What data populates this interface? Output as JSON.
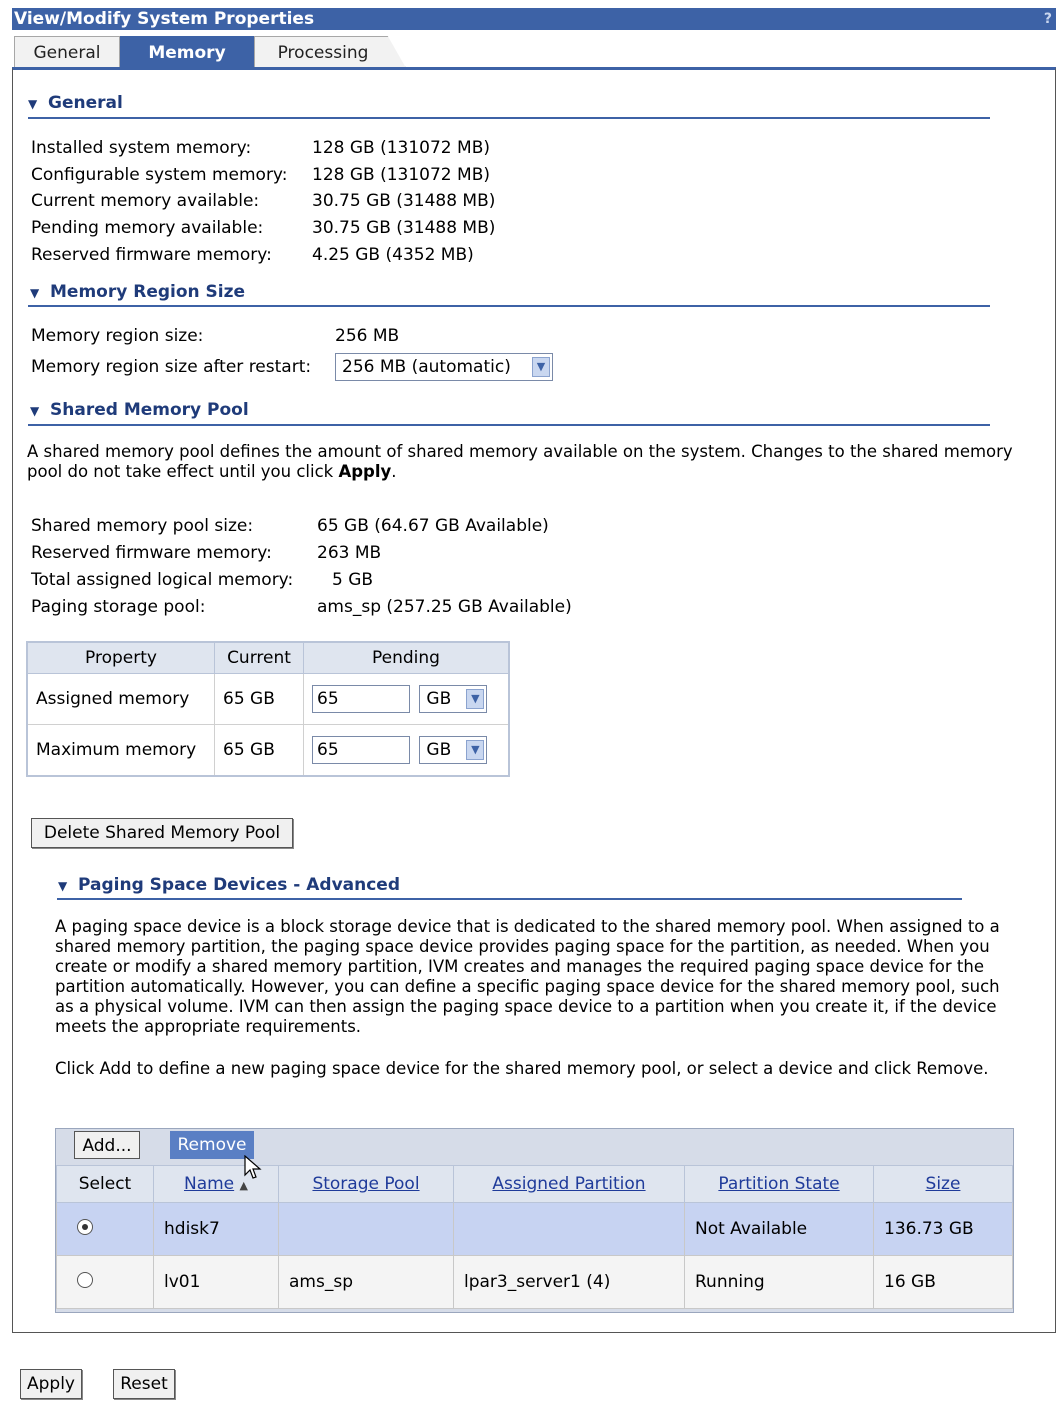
{
  "window": {
    "title": "View/Modify System Properties",
    "help": "?"
  },
  "tabs": [
    {
      "label": "General"
    },
    {
      "label": "Memory"
    },
    {
      "label": "Processing"
    }
  ],
  "general": {
    "heading": "General",
    "rows": [
      {
        "label": "Installed system memory:",
        "value": "128 GB (131072 MB)"
      },
      {
        "label": "Configurable system memory:",
        "value": "128 GB (131072 MB)"
      },
      {
        "label": "Current memory available:",
        "value": "30.75 GB (31488 MB)"
      },
      {
        "label": "Pending memory available:",
        "value": "30.75 GB (31488 MB)"
      },
      {
        "label": "Reserved firmware memory:",
        "value": "4.25 GB (4352 MB)"
      }
    ]
  },
  "region": {
    "heading": "Memory Region Size",
    "size_label": "Memory region size:",
    "size_value": "256 MB",
    "restart_label": "Memory region size after restart:",
    "restart_value": "256 MB (automatic)"
  },
  "pool": {
    "heading": "Shared Memory Pool",
    "desc_pre": "A shared memory pool defines the amount of shared memory available on the system. Changes to the shared memory pool do not take effect until you click ",
    "desc_bold": "Apply",
    "desc_post": ".",
    "rows": [
      {
        "label": "Shared memory pool size:",
        "value": "65 GB (64.67 GB Available)"
      },
      {
        "label": "Reserved firmware memory:",
        "value": "263 MB"
      },
      {
        "label": "Total assigned logical memory:",
        "value": "5 GB"
      },
      {
        "label": "Paging storage pool:",
        "value": "ams_sp (257.25 GB Available)"
      }
    ],
    "table": {
      "headers": [
        "Property",
        "Current",
        "Pending"
      ],
      "rows": [
        {
          "property": "Assigned memory",
          "current": "65 GB",
          "pending": "65",
          "unit": "GB"
        },
        {
          "property": "Maximum memory",
          "current": "65 GB",
          "pending": "65",
          "unit": "GB"
        }
      ]
    },
    "delete_button": "Delete Shared Memory Pool"
  },
  "paging": {
    "heading": "Paging Space Devices - Advanced",
    "desc1": "A paging space device is a block storage device that is dedicated to the shared memory pool. When assigned to a shared memory partition, the paging space device provides paging space for the partition, as needed. When you create or modify a shared memory partition, IVM creates and manages the required paging space device for the partition automatically. However, you can define a specific paging space device for the shared memory pool, such as a physical volume. IVM can then assign the paging space device to a partition when you create it, if the device meets the appropriate requirements.",
    "desc2": "Click Add to define a new paging space device for the shared memory pool, or select a device and click Remove.",
    "add_button": "Add...",
    "remove_button": "Remove",
    "columns": [
      "Select",
      "Name",
      "Storage Pool",
      "Assigned Partition",
      "Partition State",
      "Size"
    ],
    "devices": [
      {
        "name": "hdisk7",
        "pool": "",
        "partition": "",
        "state": "Not Available",
        "size": "136.73 GB",
        "selected": true
      },
      {
        "name": "lv01",
        "pool": "ams_sp",
        "partition": "lpar3_server1 (4)",
        "state": "Running",
        "size": "16 GB",
        "selected": false
      }
    ]
  },
  "footer": {
    "apply": "Apply",
    "reset": "Reset"
  }
}
